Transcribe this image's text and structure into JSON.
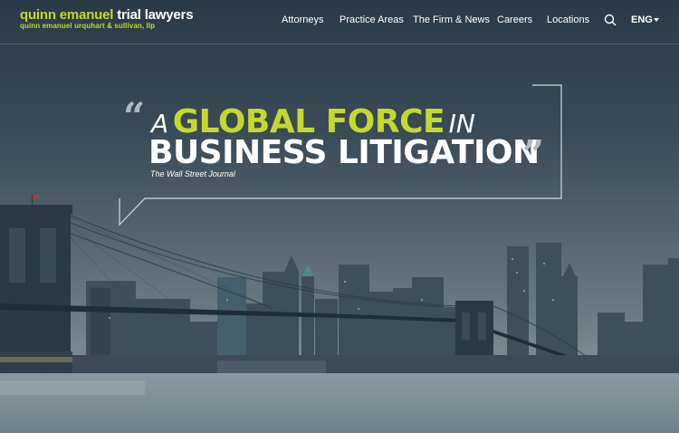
{
  "brand": {
    "name_part1": "quinn emanuel",
    "name_part2": "trial lawyers",
    "subtitle": "quinn emanuel urquhart & sullivan, llp"
  },
  "nav": {
    "items": [
      {
        "label": "Attorneys"
      },
      {
        "label": "Practice Areas"
      },
      {
        "label": "The Firm & News"
      },
      {
        "label": "Careers"
      },
      {
        "label": "Locations"
      }
    ],
    "language": "ENG"
  },
  "hero": {
    "open_quote": "“",
    "close_quote": "”",
    "headline_prefix": "A",
    "headline_highlight": "GLOBAL FORCE",
    "headline_suffix": "IN",
    "headline_line2": "BUSINESS LITIGATION",
    "attribution": "The Wall Street Journal"
  },
  "colors": {
    "accent": "#c5d82e",
    "text": "#ffffff",
    "background": "#3a4a56"
  },
  "icons": {
    "search": "search-icon",
    "dropdown": "caret-down-icon"
  }
}
